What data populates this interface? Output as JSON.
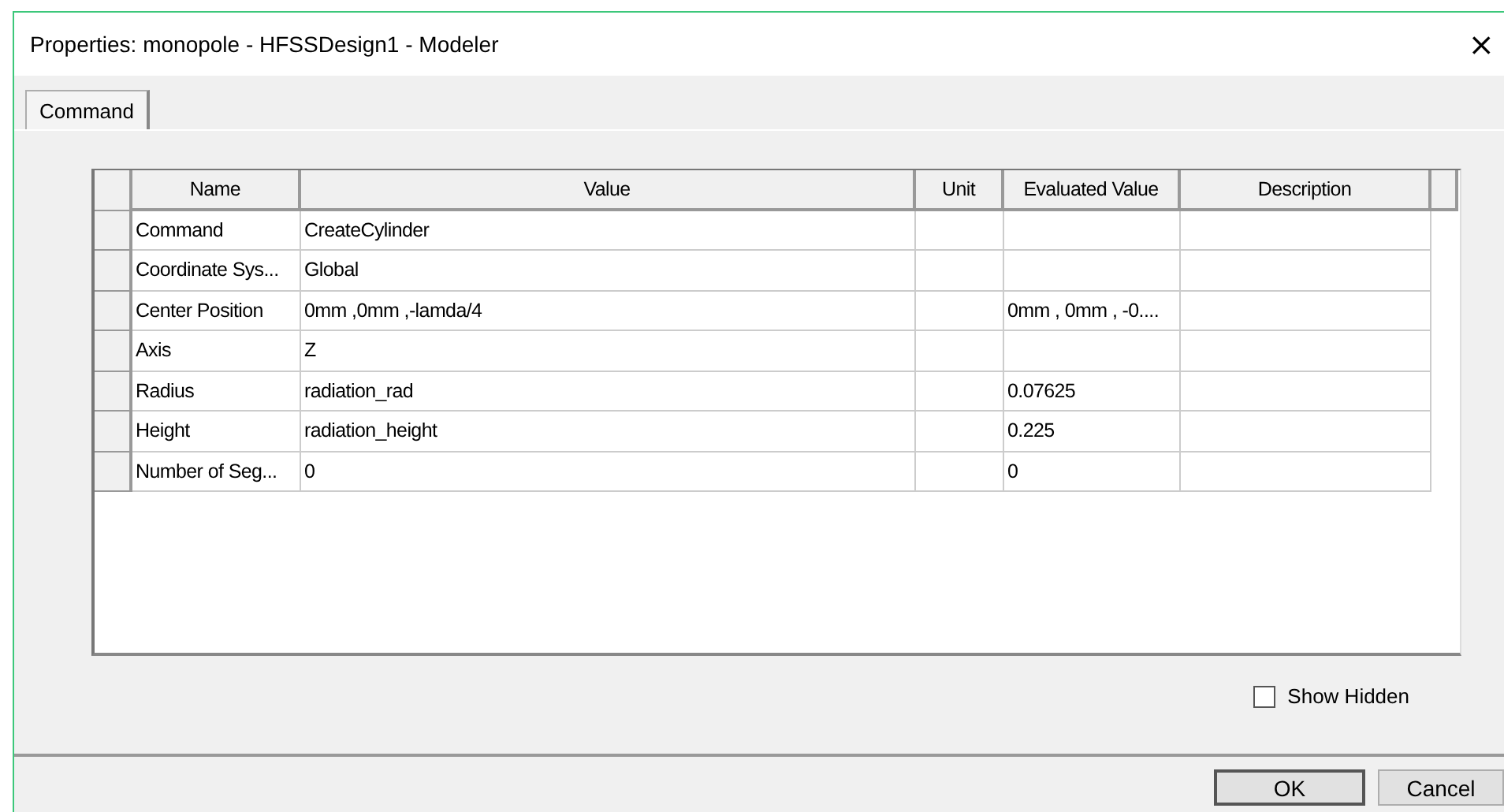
{
  "window": {
    "title": "Properties: monopole - HFSSDesign1 - Modeler",
    "close": "×"
  },
  "tabs": [
    {
      "label": "Command",
      "selected": true
    }
  ],
  "table": {
    "columns": [
      "Name",
      "Value",
      "Unit",
      "Evaluated Value",
      "Description"
    ],
    "rows": [
      {
        "name": "Command",
        "value": "CreateCylinder"
      },
      {
        "name": "Coordinate Sys...",
        "value": "Global"
      },
      {
        "name": "Center Position",
        "value": "0mm ,0mm ,-lamda/4",
        "evaluated": "0mm , 0mm , -0...."
      },
      {
        "name": "Axis",
        "value": "Z"
      },
      {
        "name": "Radius",
        "value": "radiation_rad",
        "evaluated": "0.07625"
      },
      {
        "name": "Height",
        "value": "radiation_height",
        "evaluated": "0.225"
      },
      {
        "name": "Number of Seg...",
        "value": "0",
        "evaluated": "0"
      }
    ]
  },
  "show_hidden": {
    "label": "Show Hidden",
    "checked": false
  },
  "buttons": [
    {
      "label": "OK",
      "kind": "default"
    },
    {
      "label": "Cancel",
      "kind": "normal"
    }
  ]
}
